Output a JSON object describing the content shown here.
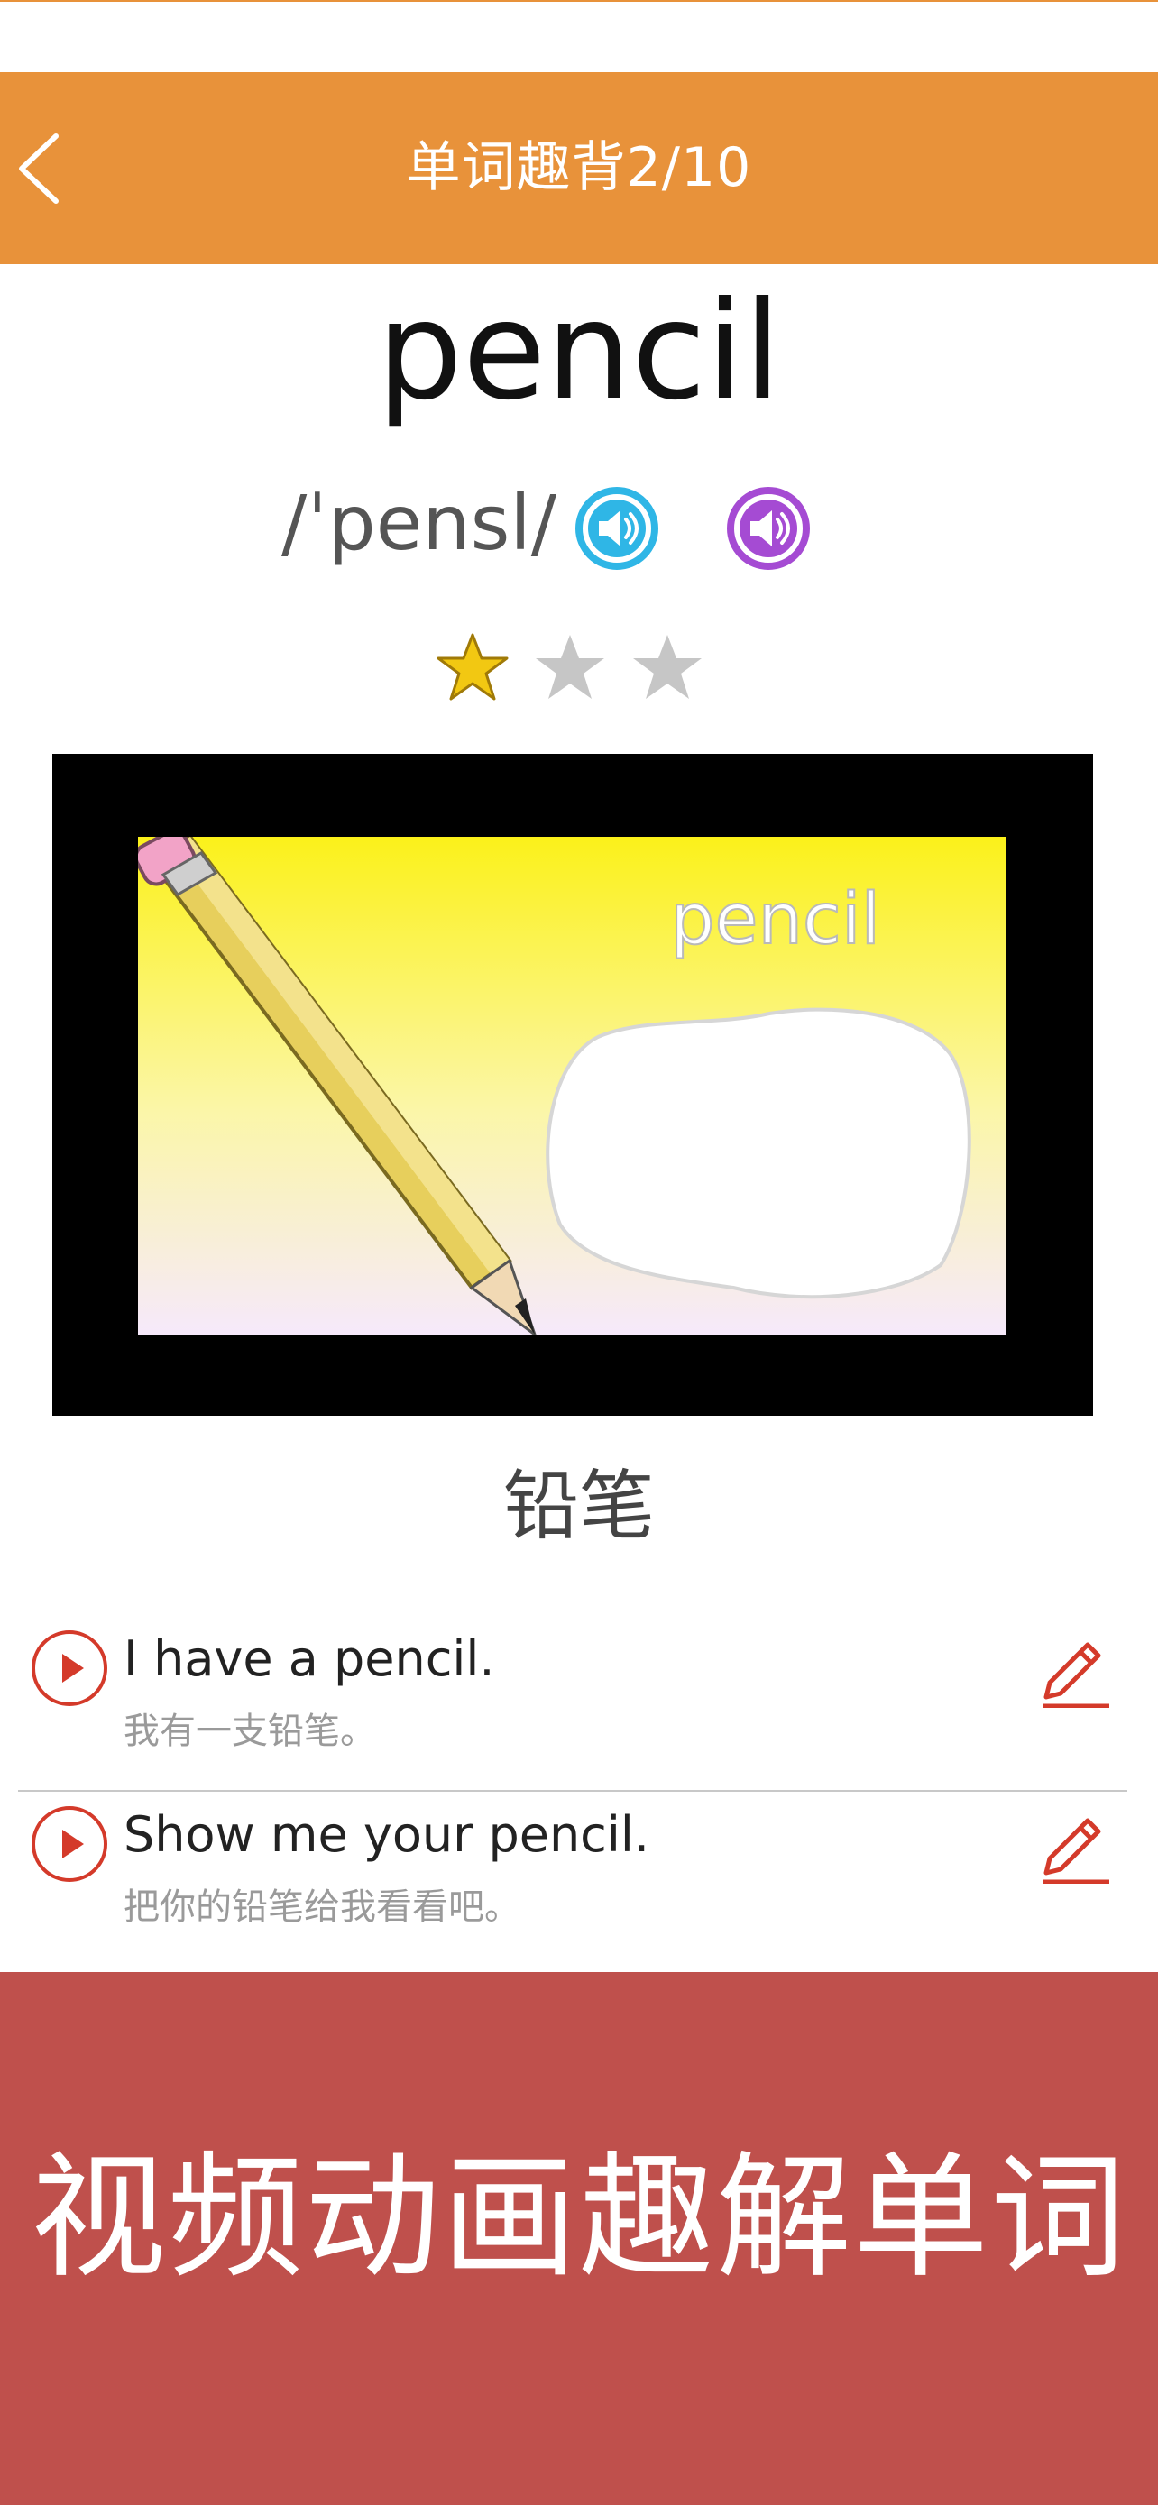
{
  "header": {
    "title": "单词趣背2/10",
    "back_icon": "chevron-left-icon",
    "color": "#e8923a"
  },
  "word": {
    "text": "pencil",
    "phonetic": "/ˈpensl/",
    "speakers": [
      "speaker-icon-blue",
      "speaker-icon-purple"
    ],
    "stars": {
      "filled": 1,
      "total": 3
    },
    "meaning": "铅笔"
  },
  "media": {
    "caption": "pencil"
  },
  "sentences": [
    {
      "en": "I have a pencil.",
      "cn": "我有一支铅笔。"
    },
    {
      "en": "Show me your pencil.",
      "cn": "把你的铅笔给我看看吧。"
    }
  ],
  "banner": {
    "text": "视频动画趣解单词",
    "color": "#bf504c"
  },
  "colors": {
    "accent": "#e8923a",
    "play_red": "#d43a2a",
    "speaker_blue": "#2fb6e6",
    "speaker_purple": "#a54bd3",
    "star_gold": "#f2c812",
    "star_gray": "#c6c6c6"
  }
}
